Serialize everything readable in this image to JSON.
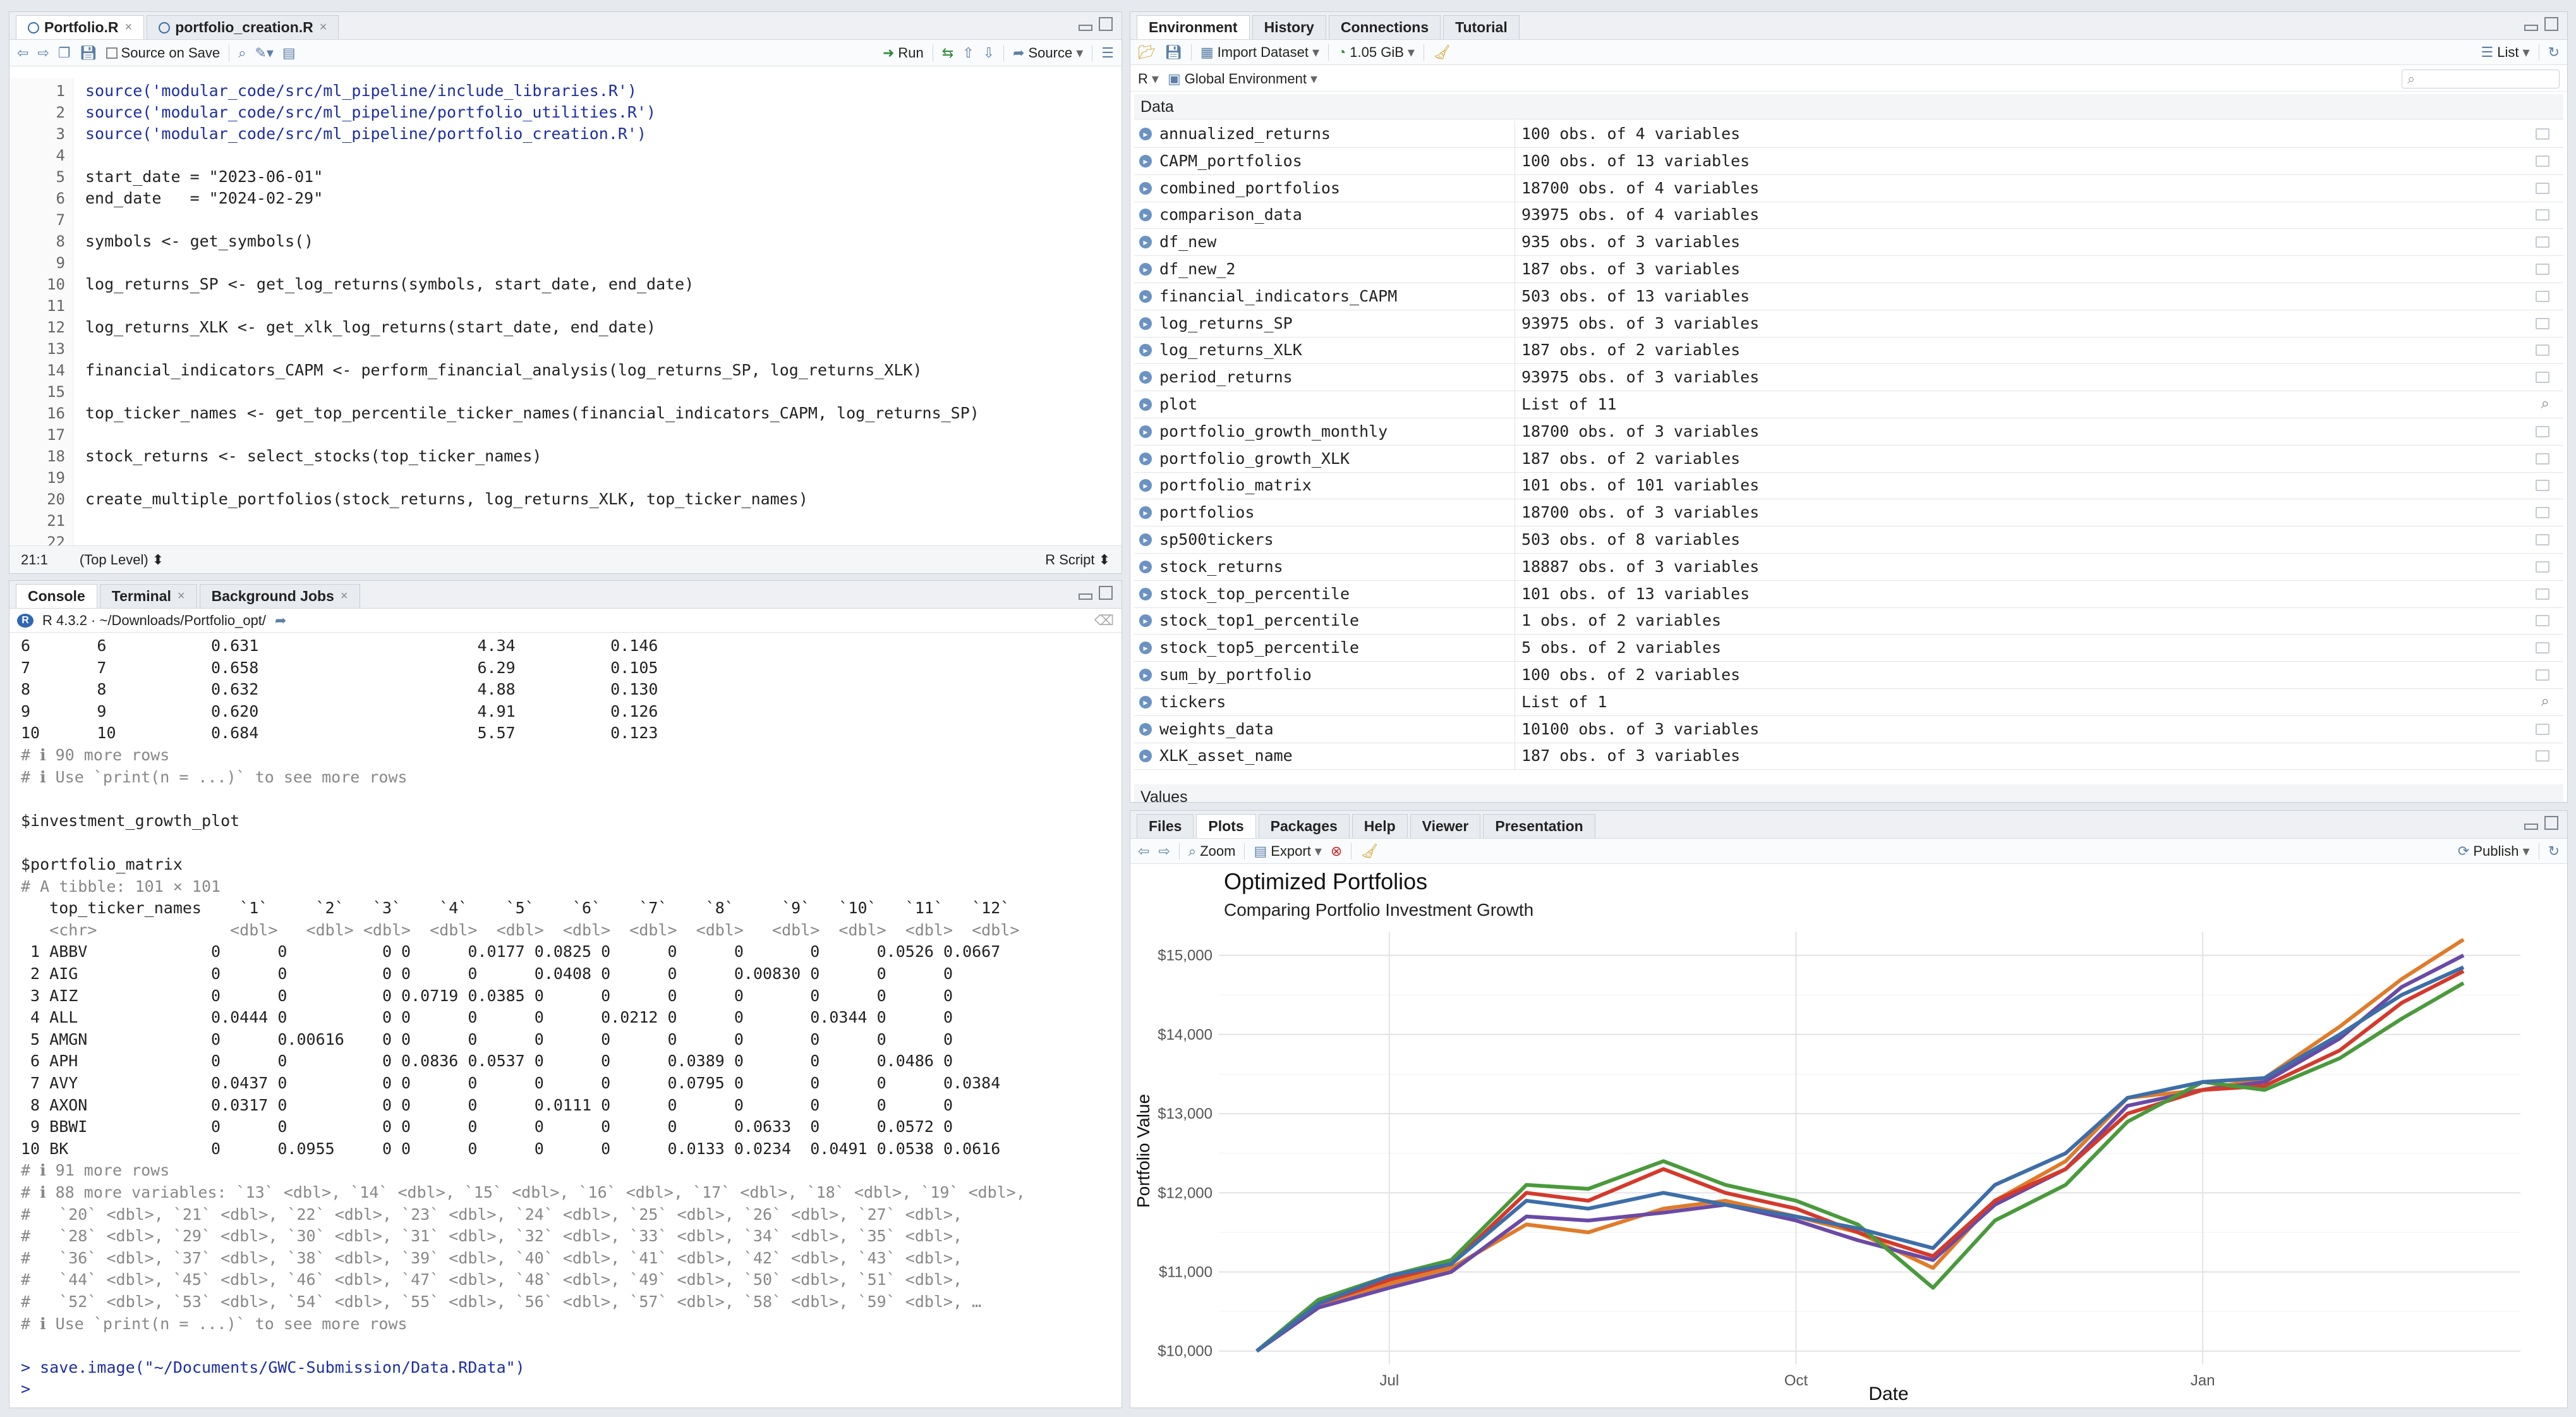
{
  "editor": {
    "tabs": [
      {
        "label": "Portfolio.R"
      },
      {
        "label": "portfolio_creation.R"
      }
    ],
    "toolbar": {
      "source_on_save": "Source on Save",
      "run": "Run",
      "source": "Source"
    },
    "lines": [
      {
        "n": "1",
        "text": "source('modular_code/src/ml_pipeline/include_libraries.R')"
      },
      {
        "n": "2",
        "text": "source('modular_code/src/ml_pipeline/portfolio_utilities.R')"
      },
      {
        "n": "3",
        "text": "source('modular_code/src/ml_pipeline/portfolio_creation.R')"
      },
      {
        "n": "4",
        "text": ""
      },
      {
        "n": "5",
        "text": "start_date = \"2023-06-01\""
      },
      {
        "n": "6",
        "text": "end_date   = \"2024-02-29\""
      },
      {
        "n": "7",
        "text": ""
      },
      {
        "n": "8",
        "text": "symbols <- get_symbols()"
      },
      {
        "n": "9",
        "text": ""
      },
      {
        "n": "10",
        "text": "log_returns_SP <- get_log_returns(symbols, start_date, end_date)"
      },
      {
        "n": "11",
        "text": ""
      },
      {
        "n": "12",
        "text": "log_returns_XLK <- get_xlk_log_returns(start_date, end_date)"
      },
      {
        "n": "13",
        "text": ""
      },
      {
        "n": "14",
        "text": "financial_indicators_CAPM <- perform_financial_analysis(log_returns_SP, log_returns_XLK)"
      },
      {
        "n": "15",
        "text": ""
      },
      {
        "n": "16",
        "text": "top_ticker_names <- get_top_percentile_ticker_names(financial_indicators_CAPM, log_returns_SP)"
      },
      {
        "n": "17",
        "text": ""
      },
      {
        "n": "18",
        "text": "stock_returns <- select_stocks(top_ticker_names)"
      },
      {
        "n": "19",
        "text": ""
      },
      {
        "n": "20",
        "text": "create_multiple_portfolios(stock_returns, log_returns_XLK, top_ticker_names)"
      },
      {
        "n": "21",
        "text": ""
      },
      {
        "n": "22",
        "text": ""
      }
    ],
    "status": {
      "pos": "21:1",
      "scope": "(Top Level) ⬍",
      "type": "R Script ⬍"
    }
  },
  "console": {
    "tabs": [
      {
        "label": "Console"
      },
      {
        "label": "Terminal"
      },
      {
        "label": "Background Jobs"
      }
    ],
    "header": "R 4.3.2 · ~/Downloads/Portfolio_opt/",
    "lines": [
      {
        "t": "6       6           0.631                       4.34          0.146",
        "c": ""
      },
      {
        "t": "7       7           0.658                       6.29          0.105",
        "c": ""
      },
      {
        "t": "8       8           0.632                       4.88          0.130",
        "c": ""
      },
      {
        "t": "9       9           0.620                       4.91          0.126",
        "c": ""
      },
      {
        "t": "10      10          0.684                       5.57          0.123",
        "c": ""
      },
      {
        "t": "# ℹ 90 more rows",
        "c": "grey"
      },
      {
        "t": "# ℹ Use `print(n = ...)` to see more rows",
        "c": "grey"
      },
      {
        "t": "",
        "c": ""
      },
      {
        "t": "$investment_growth_plot",
        "c": ""
      },
      {
        "t": "",
        "c": ""
      },
      {
        "t": "$portfolio_matrix",
        "c": ""
      },
      {
        "t": "# A tibble: 101 × 101",
        "c": "grey"
      },
      {
        "t": "   top_ticker_names    `1`     `2`   `3`    `4`    `5`    `6`    `7`    `8`     `9`   `10`   `11`   `12`",
        "c": ""
      },
      {
        "t": "   <chr>              <dbl>   <dbl> <dbl>  <dbl>  <dbl>  <dbl>  <dbl>  <dbl>   <dbl>  <dbl>  <dbl>  <dbl>",
        "c": "grey"
      },
      {
        "t": " 1 ABBV             0      0          0 0      0.0177 0.0825 0      0      0       0      0.0526 0.0667",
        "c": ""
      },
      {
        "t": " 2 AIG              0      0          0 0      0      0.0408 0      0      0.00830 0      0      0",
        "c": ""
      },
      {
        "t": " 3 AIZ              0      0          0 0.0719 0.0385 0      0      0      0       0      0      0",
        "c": ""
      },
      {
        "t": " 4 ALL              0.0444 0          0 0      0      0      0.0212 0      0       0.0344 0      0",
        "c": ""
      },
      {
        "t": " 5 AMGN             0      0.00616    0 0      0      0      0      0      0       0      0      0",
        "c": ""
      },
      {
        "t": " 6 APH              0      0          0 0.0836 0.0537 0      0      0.0389 0       0      0.0486 0",
        "c": ""
      },
      {
        "t": " 7 AVY              0.0437 0          0 0      0      0      0      0.0795 0       0      0      0.0384",
        "c": ""
      },
      {
        "t": " 8 AXON             0.0317 0          0 0      0      0.0111 0      0      0       0      0      0",
        "c": ""
      },
      {
        "t": " 9 BBWI             0      0          0 0      0      0      0      0      0.0633  0      0.0572 0",
        "c": ""
      },
      {
        "t": "10 BK               0      0.0955     0 0      0      0      0      0.0133 0.0234  0.0491 0.0538 0.0616",
        "c": ""
      },
      {
        "t": "# ℹ 91 more rows",
        "c": "grey"
      },
      {
        "t": "# ℹ 88 more variables: `13` <dbl>, `14` <dbl>, `15` <dbl>, `16` <dbl>, `17` <dbl>, `18` <dbl>, `19` <dbl>,",
        "c": "grey"
      },
      {
        "t": "#   `20` <dbl>, `21` <dbl>, `22` <dbl>, `23` <dbl>, `24` <dbl>, `25` <dbl>, `26` <dbl>, `27` <dbl>,",
        "c": "grey"
      },
      {
        "t": "#   `28` <dbl>, `29` <dbl>, `30` <dbl>, `31` <dbl>, `32` <dbl>, `33` <dbl>, `34` <dbl>, `35` <dbl>,",
        "c": "grey"
      },
      {
        "t": "#   `36` <dbl>, `37` <dbl>, `38` <dbl>, `39` <dbl>, `40` <dbl>, `41` <dbl>, `42` <dbl>, `43` <dbl>,",
        "c": "grey"
      },
      {
        "t": "#   `44` <dbl>, `45` <dbl>, `46` <dbl>, `47` <dbl>, `48` <dbl>, `49` <dbl>, `50` <dbl>, `51` <dbl>,",
        "c": "grey"
      },
      {
        "t": "#   `52` <dbl>, `53` <dbl>, `54` <dbl>, `55` <dbl>, `56` <dbl>, `57` <dbl>, `58` <dbl>, `59` <dbl>, …",
        "c": "grey"
      },
      {
        "t": "# ℹ Use `print(n = ...)` to see more rows",
        "c": "grey"
      },
      {
        "t": "",
        "c": ""
      },
      {
        "t": "> save.image(\"~/Documents/GWC-Submission/Data.RData\")",
        "c": "blue"
      },
      {
        "t": ">",
        "c": "blue"
      }
    ]
  },
  "environment": {
    "tabs": [
      {
        "label": "Environment"
      },
      {
        "label": "History"
      },
      {
        "label": "Connections"
      },
      {
        "label": "Tutorial"
      }
    ],
    "toolbar": {
      "import": "Import Dataset",
      "memory": "1.05 GiB",
      "view": "List",
      "lang": "R",
      "scope": "Global Environment"
    },
    "data_header": "Data",
    "values_header": "Values",
    "rows": [
      {
        "name": "annualized_returns",
        "value": "100 obs. of 4 variables"
      },
      {
        "name": "CAPM_portfolios",
        "value": "100 obs. of 13 variables"
      },
      {
        "name": "combined_portfolios",
        "value": "18700 obs. of 4 variables"
      },
      {
        "name": "comparison_data",
        "value": "93975 obs. of 4 variables"
      },
      {
        "name": "df_new",
        "value": "935 obs. of 3 variables"
      },
      {
        "name": "df_new_2",
        "value": "187 obs. of 3 variables"
      },
      {
        "name": "financial_indicators_CAPM",
        "value": "503 obs. of 13 variables"
      },
      {
        "name": "log_returns_SP",
        "value": "93975 obs. of 3 variables"
      },
      {
        "name": "log_returns_XLK",
        "value": "187 obs. of 2 variables"
      },
      {
        "name": "period_returns",
        "value": "93975 obs. of 3 variables"
      },
      {
        "name": "plot",
        "value": "List of  11"
      },
      {
        "name": "portfolio_growth_monthly",
        "value": "18700 obs. of 3 variables"
      },
      {
        "name": "portfolio_growth_XLK",
        "value": "187 obs. of 2 variables"
      },
      {
        "name": "portfolio_matrix",
        "value": "101 obs. of 101 variables"
      },
      {
        "name": "portfolios",
        "value": "18700 obs. of 3 variables"
      },
      {
        "name": "sp500tickers",
        "value": "503 obs. of 8 variables"
      },
      {
        "name": "stock_returns",
        "value": "18887 obs. of 3 variables"
      },
      {
        "name": "stock_top_percentile",
        "value": "101 obs. of 13 variables"
      },
      {
        "name": "stock_top1_percentile",
        "value": "1 obs. of 2 variables"
      },
      {
        "name": "stock_top5_percentile",
        "value": "5 obs. of 2 variables"
      },
      {
        "name": "sum_by_portfolio",
        "value": "100 obs. of 2 variables"
      },
      {
        "name": "tickers",
        "value": "List of  1"
      },
      {
        "name": "weights_data",
        "value": "10100 obs. of 3 variables"
      },
      {
        "name": "XLK_asset_name",
        "value": "187 obs. of 3 variables"
      }
    ]
  },
  "plots": {
    "tabs": [
      {
        "label": "Files"
      },
      {
        "label": "Plots"
      },
      {
        "label": "Packages"
      },
      {
        "label": "Help"
      },
      {
        "label": "Viewer"
      },
      {
        "label": "Presentation"
      }
    ],
    "toolbar": {
      "zoom": "Zoom",
      "export": "Export",
      "publish": "Publish"
    }
  },
  "chart_data": {
    "type": "line",
    "title": "Optimized Portfolios",
    "subtitle": "Comparing Portfolio Investment Growth",
    "xlabel": "Date",
    "ylabel": "Portfolio Value",
    "x_range": [
      "2023-06-01",
      "2024-02-29"
    ],
    "ylim": [
      9950,
      15300
    ],
    "x_ticks": [
      {
        "label": "Jul",
        "date": "2023-07-01"
      },
      {
        "label": "Oct",
        "date": "2023-10-01"
      },
      {
        "label": "Jan",
        "date": "2024-01-01"
      }
    ],
    "y_ticks": [
      {
        "label": "$10,000",
        "value": 10000
      },
      {
        "label": "$11,000",
        "value": 11000
      },
      {
        "label": "$12,000",
        "value": 12000
      },
      {
        "label": "$13,000",
        "value": 13000
      },
      {
        "label": "$14,000",
        "value": 14000
      },
      {
        "label": "$15,000",
        "value": 15000
      }
    ],
    "grid": true,
    "series": [
      {
        "color": "#e07b2a",
        "points": [
          [
            "2023-06-01",
            10000
          ],
          [
            "2023-06-15",
            10600
          ],
          [
            "2023-07-01",
            10850
          ],
          [
            "2023-07-15",
            11050
          ],
          [
            "2023-08-01",
            11600
          ],
          [
            "2023-08-15",
            11500
          ],
          [
            "2023-09-01",
            11800
          ],
          [
            "2023-09-15",
            11900
          ],
          [
            "2023-10-01",
            11700
          ],
          [
            "2023-10-15",
            11500
          ],
          [
            "2023-11-01",
            11050
          ],
          [
            "2023-11-15",
            11900
          ],
          [
            "2023-12-01",
            12400
          ],
          [
            "2023-12-15",
            13200
          ],
          [
            "2024-01-01",
            13300
          ],
          [
            "2024-01-15",
            13450
          ],
          [
            "2024-02-01",
            14100
          ],
          [
            "2024-02-15",
            14700
          ],
          [
            "2024-02-29",
            15200
          ]
        ]
      },
      {
        "color": "#6a4aa5",
        "points": [
          [
            "2023-06-01",
            10000
          ],
          [
            "2023-06-15",
            10550
          ],
          [
            "2023-07-01",
            10800
          ],
          [
            "2023-07-15",
            11000
          ],
          [
            "2023-08-01",
            11700
          ],
          [
            "2023-08-15",
            11650
          ],
          [
            "2023-09-01",
            11750
          ],
          [
            "2023-09-15",
            11850
          ],
          [
            "2023-10-01",
            11650
          ],
          [
            "2023-10-15",
            11400
          ],
          [
            "2023-11-01",
            11150
          ],
          [
            "2023-11-15",
            11850
          ],
          [
            "2023-12-01",
            12300
          ],
          [
            "2023-12-15",
            13100
          ],
          [
            "2024-01-01",
            13300
          ],
          [
            "2024-01-15",
            13400
          ],
          [
            "2024-02-01",
            13950
          ],
          [
            "2024-02-15",
            14600
          ],
          [
            "2024-02-29",
            15000
          ]
        ]
      },
      {
        "color": "#d33a2c",
        "points": [
          [
            "2023-06-01",
            10000
          ],
          [
            "2023-06-15",
            10600
          ],
          [
            "2023-07-01",
            10900
          ],
          [
            "2023-07-15",
            11100
          ],
          [
            "2023-08-01",
            12000
          ],
          [
            "2023-08-15",
            11900
          ],
          [
            "2023-09-01",
            12300
          ],
          [
            "2023-09-15",
            12000
          ],
          [
            "2023-10-01",
            11800
          ],
          [
            "2023-10-15",
            11500
          ],
          [
            "2023-11-01",
            11200
          ],
          [
            "2023-11-15",
            11900
          ],
          [
            "2023-12-01",
            12300
          ],
          [
            "2023-12-15",
            13000
          ],
          [
            "2024-01-01",
            13300
          ],
          [
            "2024-01-15",
            13350
          ],
          [
            "2024-02-01",
            13800
          ],
          [
            "2024-02-15",
            14400
          ],
          [
            "2024-02-29",
            14800
          ]
        ]
      },
      {
        "color": "#4a9a3c",
        "points": [
          [
            "2023-06-01",
            10000
          ],
          [
            "2023-06-15",
            10650
          ],
          [
            "2023-07-01",
            10950
          ],
          [
            "2023-07-15",
            11150
          ],
          [
            "2023-08-01",
            12100
          ],
          [
            "2023-08-15",
            12050
          ],
          [
            "2023-09-01",
            12400
          ],
          [
            "2023-09-15",
            12100
          ],
          [
            "2023-10-01",
            11900
          ],
          [
            "2023-10-15",
            11600
          ],
          [
            "2023-11-01",
            10800
          ],
          [
            "2023-11-15",
            11650
          ],
          [
            "2023-12-01",
            12100
          ],
          [
            "2023-12-15",
            12900
          ],
          [
            "2024-01-01",
            13400
          ],
          [
            "2024-01-15",
            13300
          ],
          [
            "2024-02-01",
            13700
          ],
          [
            "2024-02-15",
            14200
          ],
          [
            "2024-02-29",
            14650
          ]
        ]
      },
      {
        "color": "#3d6ea8",
        "points": [
          [
            "2023-06-01",
            10000
          ],
          [
            "2023-06-15",
            10600
          ],
          [
            "2023-07-01",
            10950
          ],
          [
            "2023-07-15",
            11100
          ],
          [
            "2023-08-01",
            11900
          ],
          [
            "2023-08-15",
            11800
          ],
          [
            "2023-09-01",
            12000
          ],
          [
            "2023-09-15",
            11850
          ],
          [
            "2023-10-01",
            11700
          ],
          [
            "2023-10-15",
            11550
          ],
          [
            "2023-11-01",
            11300
          ],
          [
            "2023-11-15",
            12100
          ],
          [
            "2023-12-01",
            12500
          ],
          [
            "2023-12-15",
            13200
          ],
          [
            "2024-01-01",
            13400
          ],
          [
            "2024-01-15",
            13450
          ],
          [
            "2024-02-01",
            14000
          ],
          [
            "2024-02-15",
            14500
          ],
          [
            "2024-02-29",
            14850
          ]
        ]
      }
    ]
  }
}
